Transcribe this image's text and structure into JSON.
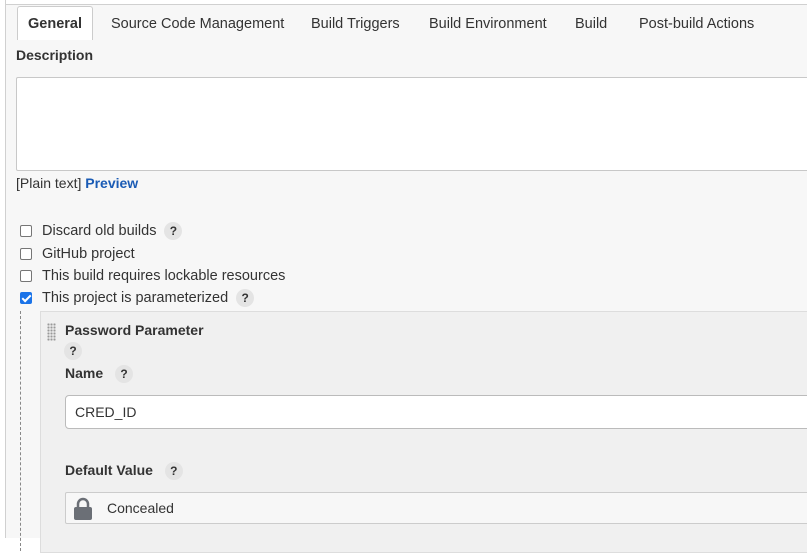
{
  "tabs": [
    {
      "label": "General"
    },
    {
      "label": "Source Code Management"
    },
    {
      "label": "Build Triggers"
    },
    {
      "label": "Build Environment"
    },
    {
      "label": "Build"
    },
    {
      "label": "Post-build Actions"
    }
  ],
  "description": {
    "label": "Description",
    "value": "",
    "format_label": "[Plain text]",
    "preview_link": "Preview"
  },
  "options": [
    {
      "label": "Discard old builds",
      "checked": false,
      "help": "?"
    },
    {
      "label": "GitHub project",
      "checked": false
    },
    {
      "label": "This build requires lockable resources",
      "checked": false
    },
    {
      "label": "This project is parameterized",
      "checked": true,
      "help": "?"
    }
  ],
  "parameter": {
    "title": "Password Parameter",
    "help": "?",
    "name_label": "Name",
    "name_value": "CRED_ID",
    "default_label": "Default Value",
    "default_value": "Concealed"
  },
  "colors": {
    "link": "#1a5bb5",
    "checkbox_checked": "#1a73e8",
    "panel_bg": "#f7f7f7"
  }
}
